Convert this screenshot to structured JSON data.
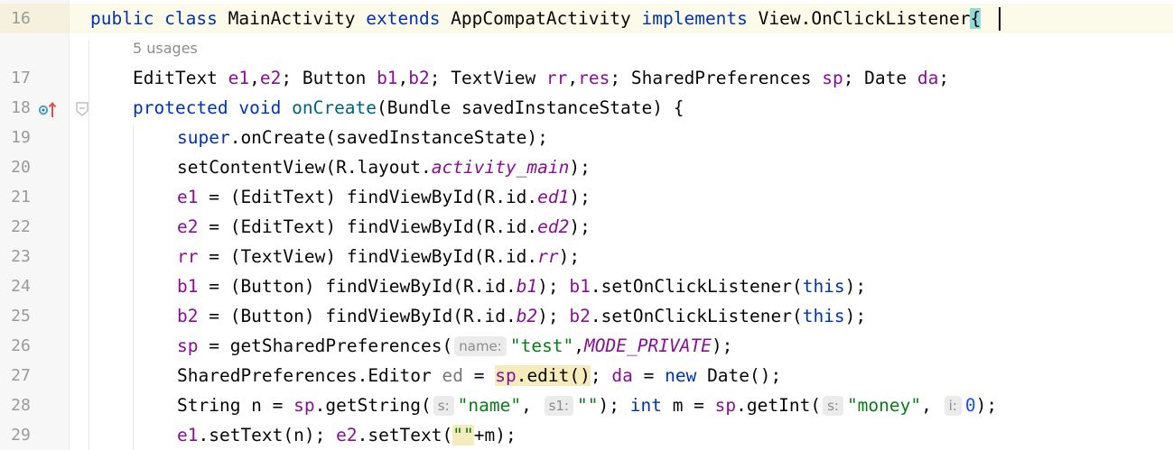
{
  "editor": {
    "language": "Java",
    "usages_hint": "5 usages",
    "lines": [
      {
        "num": "16",
        "tokens": [
          {
            "t": "public class ",
            "c": "kw"
          },
          {
            "t": "MainActivity "
          },
          {
            "t": "extends ",
            "c": "kw"
          },
          {
            "t": "AppCompatActivity "
          },
          {
            "t": "implements ",
            "c": "kw"
          },
          {
            "t": "View.OnClickListener"
          },
          {
            "t": "{",
            "c": "brace-hl"
          }
        ]
      },
      {
        "num": "17",
        "tokens": [
          {
            "t": "EditText "
          },
          {
            "t": "e1",
            "c": "fld"
          },
          {
            "t": ","
          },
          {
            "t": "e2",
            "c": "fld"
          },
          {
            "t": "; Button "
          },
          {
            "t": "b1",
            "c": "fld"
          },
          {
            "t": ","
          },
          {
            "t": "b2",
            "c": "fld"
          },
          {
            "t": "; TextView "
          },
          {
            "t": "rr",
            "c": "fld"
          },
          {
            "t": ","
          },
          {
            "t": "res",
            "c": "fld"
          },
          {
            "t": "; SharedPreferences "
          },
          {
            "t": "sp",
            "c": "fld"
          },
          {
            "t": "; Date "
          },
          {
            "t": "da",
            "c": "fld"
          },
          {
            "t": ";"
          }
        ]
      },
      {
        "num": "18",
        "tokens": [
          {
            "t": "protected void ",
            "c": "kw"
          },
          {
            "t": "onCreate",
            "c": "fn"
          },
          {
            "t": "(Bundle savedInstanceState) {"
          }
        ]
      },
      {
        "num": "19",
        "tokens": [
          {
            "t": "super",
            "c": "kw"
          },
          {
            "t": ".onCreate(savedInstanceState);"
          }
        ]
      },
      {
        "num": "20",
        "tokens": [
          {
            "t": "setContentView(R.layout."
          },
          {
            "t": "activity_main",
            "c": "it"
          },
          {
            "t": ");"
          }
        ]
      },
      {
        "num": "21",
        "tokens": [
          {
            "t": "e1",
            "c": "fld"
          },
          {
            "t": " = (EditText) findViewById(R.id."
          },
          {
            "t": "ed1",
            "c": "it"
          },
          {
            "t": ");"
          }
        ]
      },
      {
        "num": "22",
        "tokens": [
          {
            "t": "e2",
            "c": "fld"
          },
          {
            "t": " = (EditText) findViewById(R.id."
          },
          {
            "t": "ed2",
            "c": "it"
          },
          {
            "t": ");"
          }
        ]
      },
      {
        "num": "23",
        "tokens": [
          {
            "t": "rr",
            "c": "fld"
          },
          {
            "t": " = (TextView) findViewById(R.id."
          },
          {
            "t": "rr",
            "c": "it"
          },
          {
            "t": ");"
          }
        ]
      },
      {
        "num": "24",
        "tokens": [
          {
            "t": "b1",
            "c": "fld"
          },
          {
            "t": " = (Button) findViewById(R.id."
          },
          {
            "t": "b1",
            "c": "it"
          },
          {
            "t": "); "
          },
          {
            "t": "b1",
            "c": "fld"
          },
          {
            "t": ".setOnClickListener("
          },
          {
            "t": "this",
            "c": "kw"
          },
          {
            "t": ");"
          }
        ]
      },
      {
        "num": "25",
        "tokens": [
          {
            "t": "b2",
            "c": "fld"
          },
          {
            "t": " = (Button) findViewById(R.id."
          },
          {
            "t": "b2",
            "c": "it"
          },
          {
            "t": "); "
          },
          {
            "t": "b2",
            "c": "fld"
          },
          {
            "t": ".setOnClickListener("
          },
          {
            "t": "this",
            "c": "kw"
          },
          {
            "t": ");"
          }
        ]
      },
      {
        "num": "26",
        "tokens": [
          {
            "t": "sp",
            "c": "fld"
          },
          {
            "t": " = getSharedPreferences("
          },
          {
            "t": "name:",
            "c": "hint"
          },
          {
            "t": "\"test\"",
            "c": "str"
          },
          {
            "t": ","
          },
          {
            "t": "MODE_PRIVATE",
            "c": "it"
          },
          {
            "t": ");"
          }
        ]
      },
      {
        "num": "27",
        "tokens": [
          {
            "t": "SharedPreferences.Editor "
          },
          {
            "t": "ed",
            "c": "var"
          },
          {
            "t": " = "
          },
          {
            "t": "sp",
            "c": "fld hl"
          },
          {
            "t": ".edit()",
            "c": "hl"
          },
          {
            "t": "; "
          },
          {
            "t": "da",
            "c": "fld"
          },
          {
            "t": " = "
          },
          {
            "t": "new ",
            "c": "kw"
          },
          {
            "t": "Date();"
          }
        ]
      },
      {
        "num": "28",
        "tokens": [
          {
            "t": "String n = "
          },
          {
            "t": "sp",
            "c": "fld"
          },
          {
            "t": ".getString("
          },
          {
            "t": "s:",
            "c": "hint"
          },
          {
            "t": "\"name\"",
            "c": "str"
          },
          {
            "t": ", "
          },
          {
            "t": "s1:",
            "c": "hint"
          },
          {
            "t": "\"\"",
            "c": "str"
          },
          {
            "t": "); "
          },
          {
            "t": "int ",
            "c": "kw"
          },
          {
            "t": "m = "
          },
          {
            "t": "sp",
            "c": "fld"
          },
          {
            "t": ".getInt("
          },
          {
            "t": "s:",
            "c": "hint"
          },
          {
            "t": "\"money\"",
            "c": "str"
          },
          {
            "t": ", "
          },
          {
            "t": "i:",
            "c": "hint"
          },
          {
            "t": "0",
            "c": "num"
          },
          {
            "t": ");"
          }
        ]
      },
      {
        "num": "29",
        "tokens": [
          {
            "t": "e1",
            "c": "fld"
          },
          {
            "t": ".setText(n); "
          },
          {
            "t": "e2",
            "c": "fld"
          },
          {
            "t": ".setText("
          },
          {
            "t": "\"\"",
            "c": "str hl"
          },
          {
            "t": "+m);"
          }
        ]
      }
    ]
  },
  "gutter_icons": {
    "line_18_override": "override-method-icon",
    "line_18_fold": "fold-icon"
  },
  "colors": {
    "keyword": "#0033b3",
    "field": "#871094",
    "string": "#067d17",
    "number": "#1750eb",
    "method_decl": "#00627a",
    "current_line": "#fcfae8",
    "usage_highlight": "#f6ebbc",
    "brace_match": "#93d9d9"
  }
}
